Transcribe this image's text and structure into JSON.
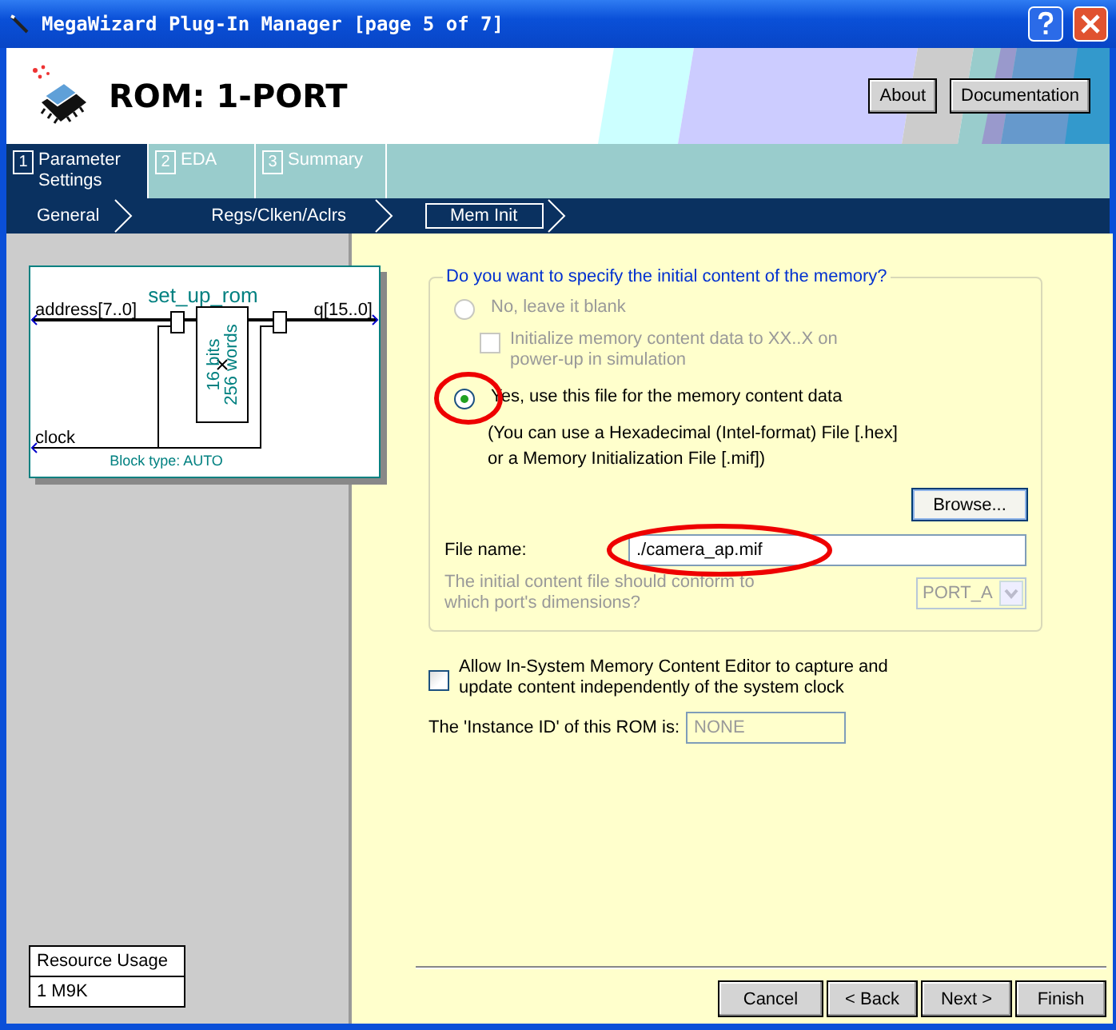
{
  "window": {
    "title": "MegaWizard Plug-In Manager [page 5 of 7]"
  },
  "header": {
    "title": "ROM: 1-PORT",
    "buttons": [
      "About",
      "Documentation"
    ]
  },
  "steps": [
    {
      "number": "1",
      "label": "Parameter\nSettings",
      "selected": true
    },
    {
      "number": "2",
      "label": "EDA",
      "selected": false
    },
    {
      "number": "3",
      "label": "Summary",
      "selected": false
    }
  ],
  "subtabs": [
    {
      "label": "General",
      "selected": false
    },
    {
      "label": "Regs/Clken/Aclrs",
      "selected": false
    },
    {
      "label": "Mem Init",
      "selected": true
    }
  ],
  "diagram": {
    "name": "set_up_rom",
    "input": "address[7..0]",
    "output": "q[15..0]",
    "width": "16 bits",
    "depth": "256 words",
    "clock": "clock",
    "block_type": "Block type: AUTO"
  },
  "resource_usage": {
    "header": "Resource Usage",
    "value": "1 M9K"
  },
  "memory_init": {
    "legend": "Do you want to specify the initial content of the memory?",
    "no_option": {
      "label": "No, leave it blank",
      "selected": false,
      "disabled": true
    },
    "init_checkbox": {
      "label": "Initialize memory content data to XX..X on\npower-up in simulation",
      "checked": false,
      "disabled": true
    },
    "yes_option": {
      "label": "Yes, use this file for the memory content data",
      "selected": true,
      "disabled": false
    },
    "note": "(You can use a Hexadecimal (Intel-format) File [.hex]\nor a Memory Initialization File [.mif])",
    "browse": "Browse...",
    "file_label": "File name:",
    "file_value": "./camera_ap.mif",
    "port_question": "The initial content file should conform to\nwhich port's dimensions?",
    "port_value": "PORT_A",
    "port_disabled": true
  },
  "allow_editor": {
    "label": "Allow In-System Memory Content Editor to capture and\nupdate content independently of the system clock",
    "checked": false
  },
  "instance_id": {
    "label": "The 'Instance ID' of this ROM is:",
    "value": "NONE"
  },
  "footer_buttons": [
    "Cancel",
    "< Back",
    "Next >",
    "Finish"
  ]
}
